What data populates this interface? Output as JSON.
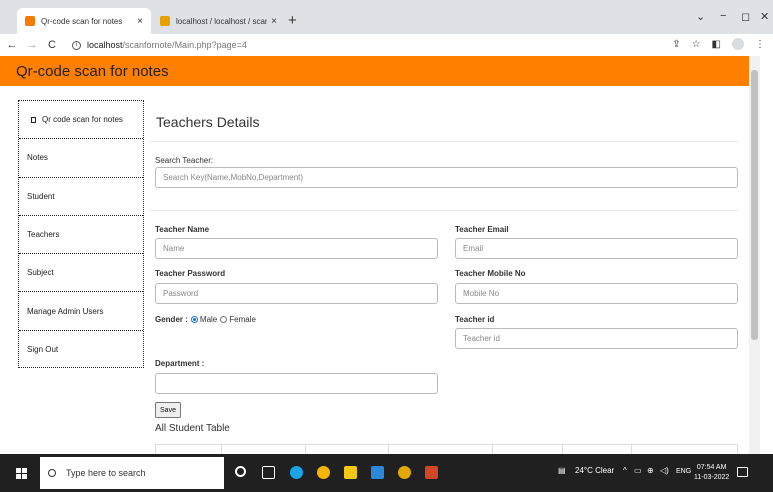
{
  "browser": {
    "tabs": [
      {
        "title": "Qr-code scan for notes",
        "close": "×",
        "favicon_color": "#f57c00"
      },
      {
        "title": "localhost / localhost / scanformo",
        "close": "×",
        "favicon_color": "#e6a100"
      }
    ],
    "new_tab": "+",
    "window_controls": {
      "dropdown": "⌄",
      "minimize": "−",
      "maximize": "◻",
      "close": "✕"
    },
    "nav": {
      "back": "←",
      "forward": "→",
      "reload": "C"
    },
    "url_host": "localhost",
    "url_path": "/scanfornote/Main.php?page=4",
    "toolbar_icons": [
      "share-icon",
      "star-icon",
      "sidebar-icon",
      "profile-icon",
      "menu-icon"
    ]
  },
  "app": {
    "title": "Qr-code scan for notes",
    "brand_color": "#ff7f00"
  },
  "sidebar": {
    "items": [
      {
        "label": "Qr code scan for notes"
      },
      {
        "label": "Notes"
      },
      {
        "label": "Student"
      },
      {
        "label": "Teachers"
      },
      {
        "label": "Subject"
      },
      {
        "label": "Manage Admin Users"
      },
      {
        "label": "Sign Out"
      }
    ]
  },
  "main": {
    "title": "Teachers Details",
    "search_label": "Search Teacher:",
    "search_placeholder": "Search Key(Name,MobNo,Department)",
    "form": {
      "name_label": "Teacher Name",
      "name_placeholder": "Name",
      "email_label": "Teacher Email",
      "email_placeholder": "Email",
      "password_label": "Teacher Password",
      "password_placeholder": "Password",
      "mobile_label": "Teacher Mobile No",
      "mobile_placeholder": "Mobile No",
      "gender_label": "Gender :",
      "gender_male": "Male",
      "gender_female": "Female",
      "gender_selected": "Male",
      "id_label": "Teacher id",
      "id_placeholder": "Teacher id",
      "department_label": "Department :",
      "department_value": "",
      "save_label": "Save"
    },
    "table_title": "All Student Table"
  },
  "taskbar": {
    "search_placeholder": "Type here to search",
    "weather": "24°C  Clear",
    "tray_up": "^",
    "language": "ENG",
    "time": "07:54 AM",
    "date": "11-03-2022"
  }
}
